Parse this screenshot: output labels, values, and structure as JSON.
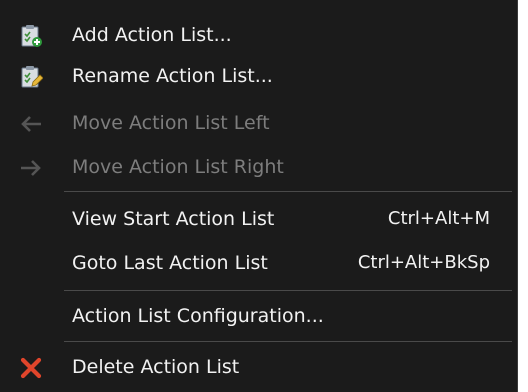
{
  "menu": {
    "items": [
      {
        "label": "Add Action List...",
        "icon": "clipboard-add-icon",
        "enabled": true,
        "shortcut": ""
      },
      {
        "label": "Rename Action List...",
        "icon": "clipboard-edit-icon",
        "enabled": true,
        "shortcut": ""
      },
      {
        "label": "Move Action List Left",
        "icon": "arrow-left-icon",
        "enabled": false,
        "shortcut": ""
      },
      {
        "label": "Move Action List Right",
        "icon": "arrow-right-icon",
        "enabled": false,
        "shortcut": ""
      },
      {
        "label": "View Start Action List",
        "icon": "",
        "enabled": true,
        "shortcut": "Ctrl+Alt+M"
      },
      {
        "label": "Goto Last Action List",
        "icon": "",
        "enabled": true,
        "shortcut": "Ctrl+Alt+BkSp"
      },
      {
        "label": "Action List Configuration...",
        "icon": "",
        "enabled": true,
        "shortcut": ""
      },
      {
        "label": "Delete Action List",
        "icon": "red-x-delete-icon",
        "enabled": true,
        "shortcut": ""
      }
    ]
  },
  "colors": {
    "menu_background": "#1b1b1b",
    "text": "#f2f2f2",
    "disabled_text": "#7d7d7d",
    "separator": "#4a4a4a",
    "delete_icon": "#e0452b",
    "clipboard_green": "#5bb847"
  }
}
